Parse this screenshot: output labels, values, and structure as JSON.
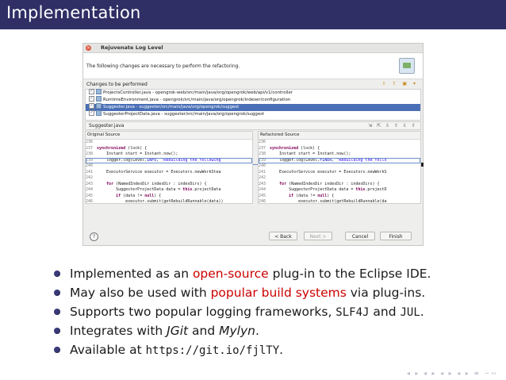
{
  "slide": {
    "title": "Implementation"
  },
  "dialog": {
    "title": "Rejuvenate Log Level",
    "description": "The following changes are necessary to perform the refactoring.",
    "changes_label": "Changes to be performed",
    "changes_tools": "⇩ ⇧ ▣ ▾",
    "changes": [
      {
        "label": "ProjectsController.java - opengrok-web/src/main/java/org/opengrok/web/api/v1/controller",
        "checked": true,
        "selected": false
      },
      {
        "label": "RuntimeEnvironment.java - opengrok/src/main/java/org/opengrok/indexer/configuration",
        "checked": true,
        "selected": false
      },
      {
        "label": "Suggester.java - suggester/src/main/java/org/opengrok/suggest",
        "checked": true,
        "selected": true
      },
      {
        "label": "SuggesterProjectData.java - suggester/src/main/java/org/opengrok/suggest",
        "checked": true,
        "selected": false
      }
    ],
    "compare_title": "Suggester.java",
    "compare_tools": "⇲ ⇱ ⇩ ⇧ ⇩ ⇧",
    "original_label": "Original Source",
    "refactored_label": "Refactored Source",
    "original_lines": [
      {
        "n": "236",
        "code": ""
      },
      {
        "n": "237",
        "code": "synchronized (lock) {"
      },
      {
        "n": "238",
        "code": "    Instant start = Instant.now();"
      },
      {
        "n": "239",
        "code": "    logger.log(Level.INFO, \"Rebuilding the following"
      },
      {
        "n": "240",
        "code": ""
      },
      {
        "n": "241",
        "code": "    ExecutorService executor = Executors.newWorkStea"
      },
      {
        "n": "242",
        "code": ""
      },
      {
        "n": "243",
        "code": "    for (NamedIndexDir indexDir : indexDirs) {"
      },
      {
        "n": "244",
        "code": "        SuggesterProjectData data = this.projectData"
      },
      {
        "n": "245",
        "code": "        if (data != null) {"
      },
      {
        "n": "246",
        "code": "            executor.submit(getRebuildRunnable(data))"
      },
      {
        "n": "247",
        "code": "        } else {"
      }
    ],
    "refactored_lines": [
      {
        "n": "236",
        "code": ""
      },
      {
        "n": "237",
        "code": "synchronized (lock) {"
      },
      {
        "n": "238",
        "code": "    Instant start = Instant.now();"
      },
      {
        "n": "239",
        "code": "    logger.log(Level.FINER, \"Rebuilding the follo"
      },
      {
        "n": "240",
        "code": ""
      },
      {
        "n": "241",
        "code": "    ExecutorService executor = Executors.newWorkS"
      },
      {
        "n": "242",
        "code": ""
      },
      {
        "n": "243",
        "code": "    for (NamedIndexDir indexDir : indexDirs) {"
      },
      {
        "n": "244",
        "code": "        SuggesterProjectData data = this.projectD"
      },
      {
        "n": "245",
        "code": "        if (data != null) {"
      },
      {
        "n": "246",
        "code": "            executor.submit(getRebuildRunnable(da"
      },
      {
        "n": "247",
        "code": "        } else {"
      }
    ],
    "help_label": "?",
    "back_label": "< Back",
    "next_label": "Next >",
    "cancel_label": "Cancel",
    "finish_label": "Finish"
  },
  "bullets": {
    "b1_pre": "Implemented as an ",
    "b1_hl": "open-source",
    "b1_post": " plug-in to the Eclipse IDE.",
    "b2_pre": "May also be used with ",
    "b2_hl": "popular build systems",
    "b2_post": " via plug-ins.",
    "b3_pre": "Supports two popular logging frameworks, ",
    "b3_m1": "SLF4J",
    "b3_mid": " and ",
    "b3_m2": "JUL",
    "b3_post": ".",
    "b4_pre": "Integrates with ",
    "b4_i1": "JGit",
    "b4_mid": " and ",
    "b4_i2": "Mylyn",
    "b4_post": ".",
    "b5_pre": "Available at ",
    "b5_url": "https://git.io/fjlTY",
    "b5_post": "."
  },
  "navbar": "◂ ▸ ◂ ▸ ◂ ▸ ◂ ▸ ≡ ∽∾"
}
